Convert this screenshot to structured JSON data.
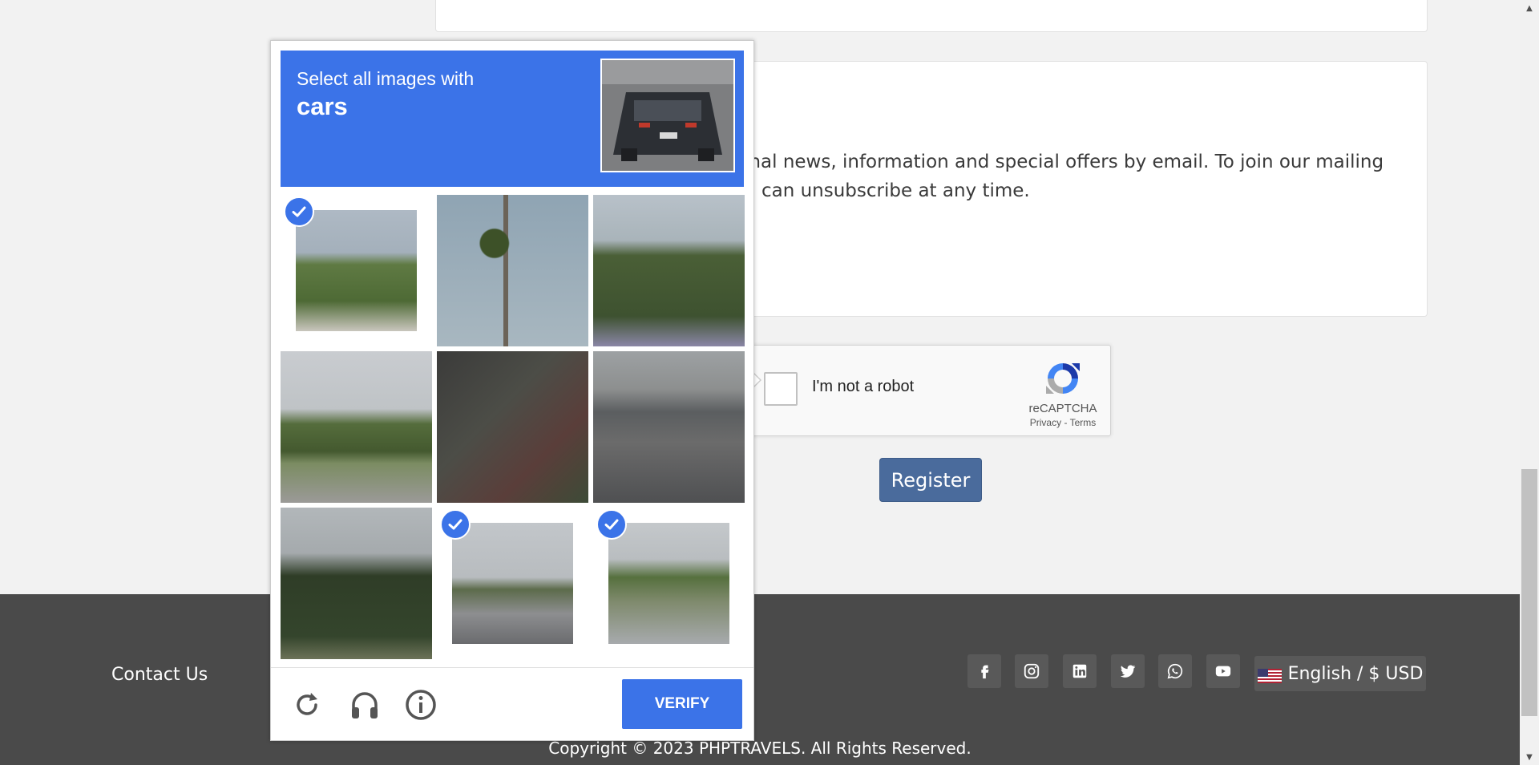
{
  "newsletter": {
    "text_line1": "ional news, information and special offers by email. To join our mailing",
    "text_line2": "ou can unsubscribe at any time."
  },
  "recaptcha_anchor": {
    "label": "I'm not a robot",
    "brand": "reCAPTCHA",
    "privacy": "Privacy",
    "separator": " - ",
    "terms": "Terms"
  },
  "register_label": "Register",
  "captcha_challenge": {
    "instruction": "Select all images with",
    "target": "cars",
    "tiles": [
      {
        "selected": true
      },
      {
        "selected": false
      },
      {
        "selected": false
      },
      {
        "selected": false
      },
      {
        "selected": false
      },
      {
        "selected": false
      },
      {
        "selected": false
      },
      {
        "selected": true
      },
      {
        "selected": true
      }
    ],
    "verify_label": "VERIFY",
    "icons": [
      "reload-icon",
      "audio-icon",
      "info-icon"
    ],
    "accent_color": "#3b73e8"
  },
  "footer": {
    "contact_label": "Contact Us",
    "social_icons": [
      "facebook-icon",
      "instagram-icon",
      "linkedin-icon",
      "twitter-icon",
      "whatsapp-icon",
      "youtube-icon"
    ],
    "language_currency": "English / $ USD",
    "copyright": "Copyright © 2023 PHPTRAVELS. All Rights Reserved."
  }
}
